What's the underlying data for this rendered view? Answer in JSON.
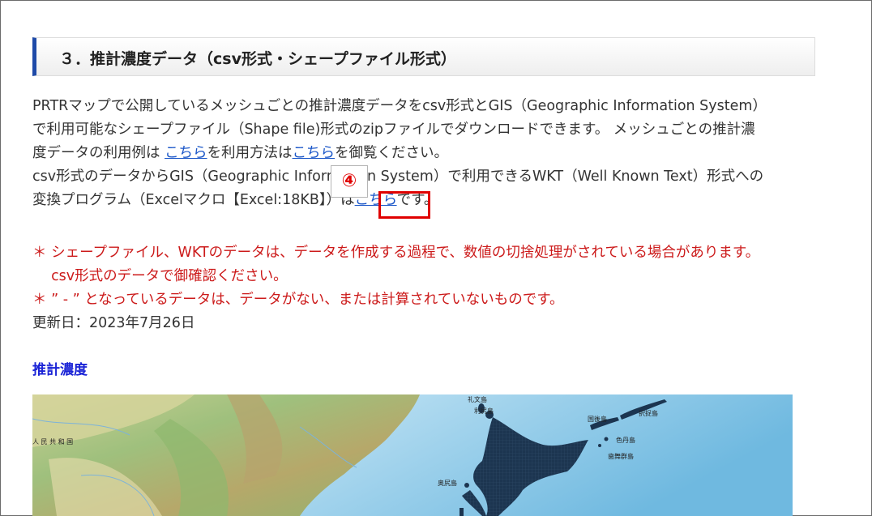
{
  "heading": "３．推計濃度データ（csv形式・シェープファイル形式）",
  "paragraph": {
    "line1": "PRTRマップで公開しているメッシュごとの推計濃度データをcsv形式とGIS（Geographic Information System）",
    "line2": "で利用可能なシェープファイル（Shape file)形式のzipファイルでダウンロードできます。 メッシュごとの推計濃",
    "line3_a": "度データの利用例は ",
    "line3_link1": "こちら",
    "line3_b": "を利用方法は",
    "line3_link2": "こちら",
    "line3_c": "を御覧ください。",
    "line4": "csv形式のデータからGIS（Geographic Information System）で利用できるWKT（Well Known Text）形式への",
    "line5_a": "変換プログラム（Excelマクロ【Excel:18KB】）は",
    "line5_link": "こちら",
    "line5_b": "です。"
  },
  "callout": "④",
  "notes": {
    "note1_line1": "＊ シェープファイル、WKTのデータは、データを作成する過程で、数値の切捨処理がされている場合があります。",
    "note1_line2": "　 csv形式のデータで御確認ください。",
    "note2": "＊ ” - ” となっているデータは、データがない、または計算されていないものです。",
    "update": "更新日：2023年7月26日"
  },
  "section_title": "推計濃度",
  "map": {
    "labels": {
      "china": "人 民 共 和 国",
      "rebun": "礼文島",
      "rishiri": "利尻島",
      "kunashiri": "国後島",
      "etorofu": "択捉島",
      "shikotan": "色丹島",
      "habomai": "歯舞群島",
      "okushiri": "奥尻島"
    }
  }
}
